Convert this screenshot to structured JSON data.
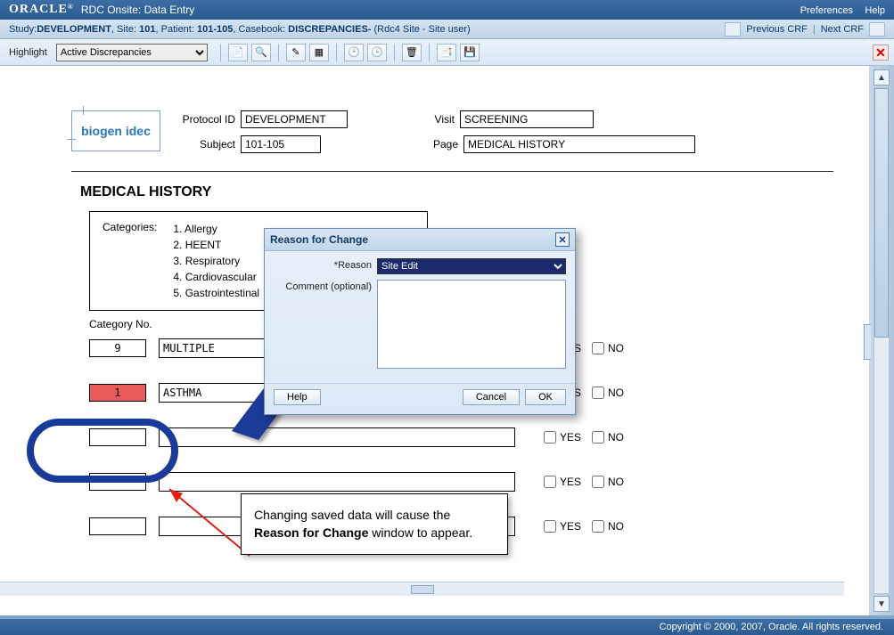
{
  "app": {
    "brand": "ORACLE",
    "title": "RDC Onsite: Data Entry",
    "pref": "Preferences",
    "help": "Help"
  },
  "crumb": {
    "study_lbl": "Study:",
    "study": "DEVELOPMENT",
    "site_lbl": "Site:",
    "site": "101",
    "patient_lbl": "Patient:",
    "patient": "101-105",
    "casebook_lbl": "Casebook:",
    "casebook": "DISCREPANCIES-",
    "role": "(Rdc4 Site - Site user)",
    "prev": "Previous CRF",
    "next": "Next CRF"
  },
  "toolbar": {
    "highlight_lbl": "Highlight",
    "highlight_val": "Active Discrepancies"
  },
  "header": {
    "logo": "biogen idec",
    "proto_lbl": "Protocol ID",
    "proto": "DEVELOPMENT",
    "visit_lbl": "Visit",
    "visit": "SCREENING",
    "subj_lbl": "Subject",
    "subj": "101-105",
    "page_lbl": "Page",
    "page": "MEDICAL HISTORY"
  },
  "section_title": "MEDICAL HISTORY",
  "categories": {
    "lbl": "Categories:",
    "items": [
      "1. Allergy",
      "2. HEENT",
      "3. Respiratory",
      "4. Cardiovascular",
      "5. Gastrointestinal"
    ]
  },
  "col_head": "Category No.",
  "rows": [
    {
      "num": "9",
      "text": "MULTIPLE",
      "yes": false,
      "no": true
    },
    {
      "num": "1",
      "text": "ASTHMA",
      "yes": true,
      "no": false,
      "highlight": true
    },
    {
      "num": "",
      "text": "",
      "yes": false,
      "no": false
    },
    {
      "num": "",
      "text": "",
      "yes": false,
      "no": false
    },
    {
      "num": "",
      "text": "",
      "yes": false,
      "no": false
    }
  ],
  "yn": {
    "yes": "YES",
    "no": "NO"
  },
  "dialog": {
    "title": "Reason for Change",
    "reason_lbl": "*Reason",
    "reason_val": "Site Edit",
    "comment_lbl": "Comment (optional)",
    "help": "Help",
    "cancel": "Cancel",
    "ok": "OK"
  },
  "callout": {
    "t1": "Changing saved data will cause the ",
    "t2": "Reason for Change",
    "t3": " window to appear."
  },
  "footer": "Copyright © 2000, 2007, Oracle. All rights reserved."
}
